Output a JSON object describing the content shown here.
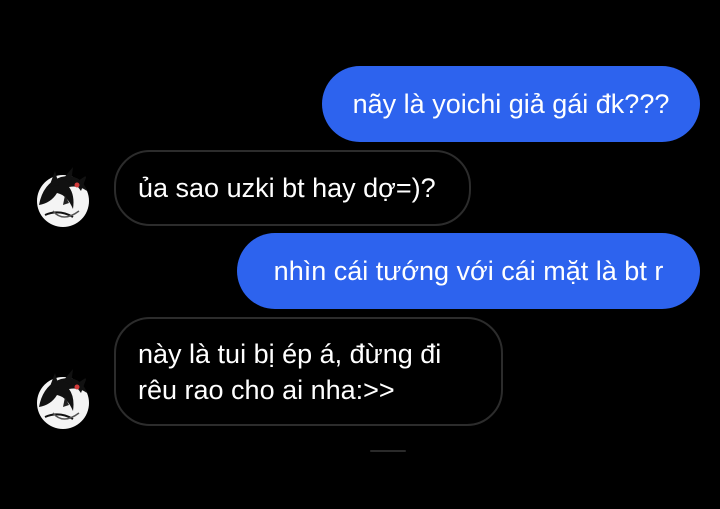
{
  "messages": [
    {
      "sender": "me",
      "text": "nãy là yoichi giả gái đk???"
    },
    {
      "sender": "other",
      "text": "ủa sao uzki bt hay dợ=)?"
    },
    {
      "sender": "me",
      "text": "nhìn cái tướng với cái mặt là bt r"
    },
    {
      "sender": "other",
      "lines": [
        "này là tui bị ép á, đừng đi",
        "rêu rao cho ai nha:>>"
      ]
    }
  ],
  "colors": {
    "background": "#000000",
    "outgoing_bubble": "#2d63ee",
    "incoming_border": "#2c2c2c",
    "text": "#ffffff"
  },
  "avatar": {
    "icon": "anime-avatar-icon"
  }
}
